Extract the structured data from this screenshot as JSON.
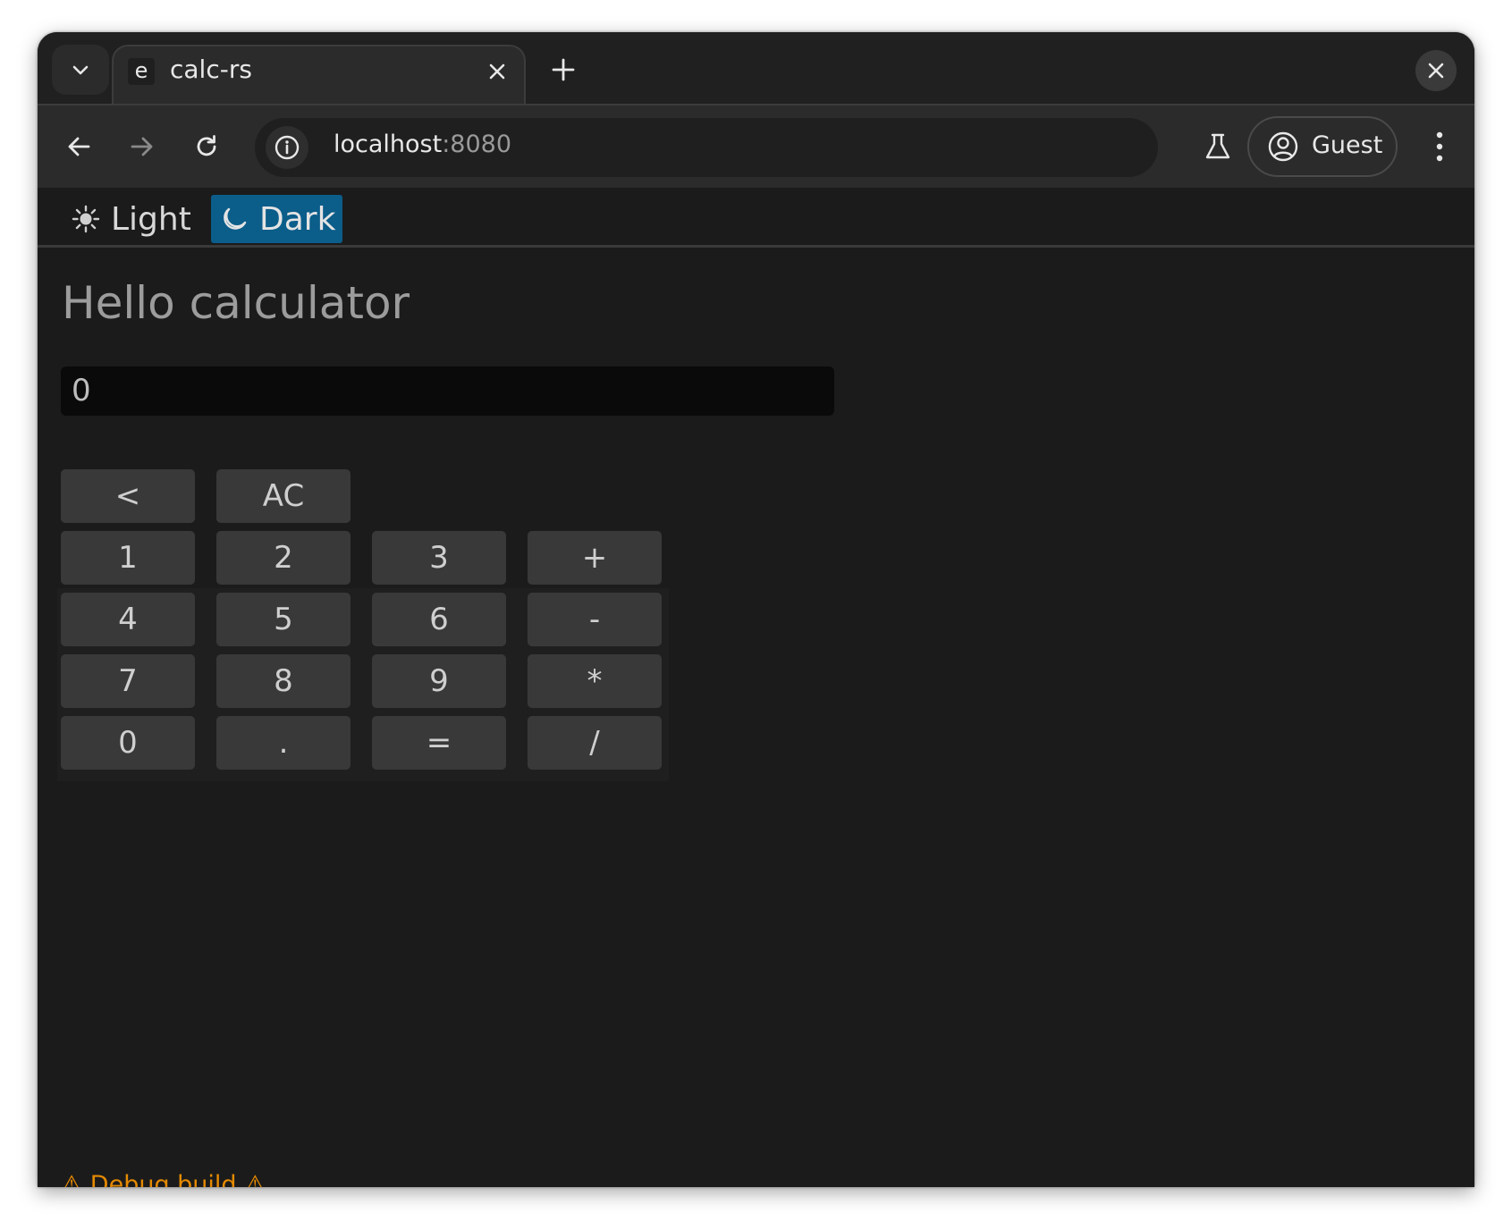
{
  "browser": {
    "tab": {
      "favicon_letter": "e",
      "title": "calc-rs"
    },
    "address": {
      "host": "localhost",
      "port": ":8080"
    },
    "profile": {
      "label": "Guest"
    }
  },
  "theme_toggle": {
    "light_label": "Light",
    "dark_label": "Dark",
    "selected": "Dark",
    "selected_color": "#0b5d8a"
  },
  "calculator": {
    "title": "Hello calculator",
    "display_value": "0",
    "keys": {
      "backspace": "<",
      "clear": "AC",
      "one": "1",
      "two": "2",
      "three": "3",
      "plus": "+",
      "four": "4",
      "five": "5",
      "six": "6",
      "minus": "-",
      "seven": "7",
      "eight": "8",
      "nine": "9",
      "multiply": "*",
      "zero": "0",
      "decimal": ".",
      "equals": "=",
      "divide": "/"
    }
  },
  "footer": {
    "debug_notice": "⚠ Debug build ⚠",
    "debug_color": "#e58a00"
  },
  "icons": [
    "chevron-down-icon",
    "close-icon",
    "plus-icon",
    "back-arrow-icon",
    "forward-arrow-icon",
    "reload-icon",
    "info-icon",
    "flask-icon",
    "account-icon",
    "more-vert-icon",
    "sun-icon",
    "moon-icon"
  ]
}
